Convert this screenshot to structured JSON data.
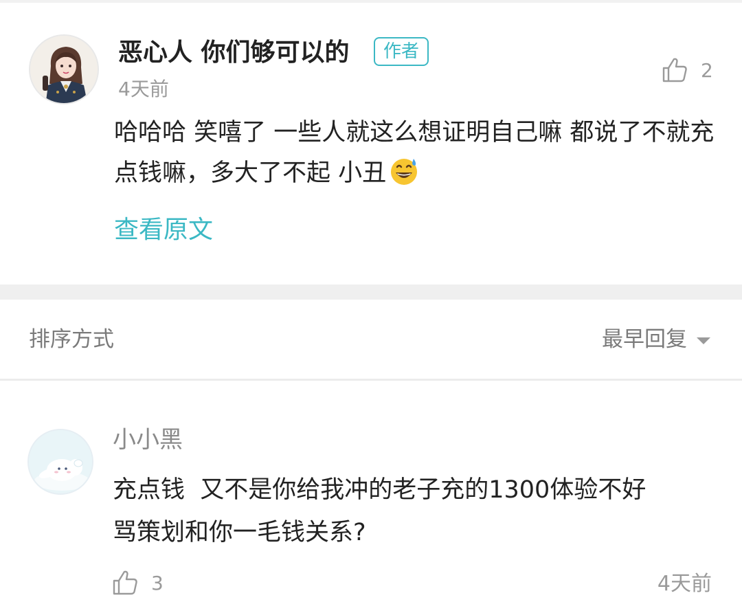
{
  "main_comment": {
    "author_name": "恶心人 你们够可以的",
    "author_badge": "作者",
    "time": "4天前",
    "like_count": "2",
    "text": "哈哈哈 笑嘻了 一些人就这么想证明自己嘛 都说了不就充点钱嘛，多大了不起 小丑",
    "emoji": "grinning-sweat-emoji",
    "view_original": "查看原文"
  },
  "sort_bar": {
    "label": "排序方式",
    "selected": "最早回复"
  },
  "reply": {
    "author_name": "小小黑",
    "text_line1": "充点钱  又不是你给我冲的老子充的1300体验不好",
    "text_line2": "骂策划和你一毛钱关系?",
    "like_count": "3",
    "time": "4天前"
  },
  "colors": {
    "accent": "#3bb8c4",
    "muted_text": "#9a9a9a",
    "divider": "#efefef"
  }
}
